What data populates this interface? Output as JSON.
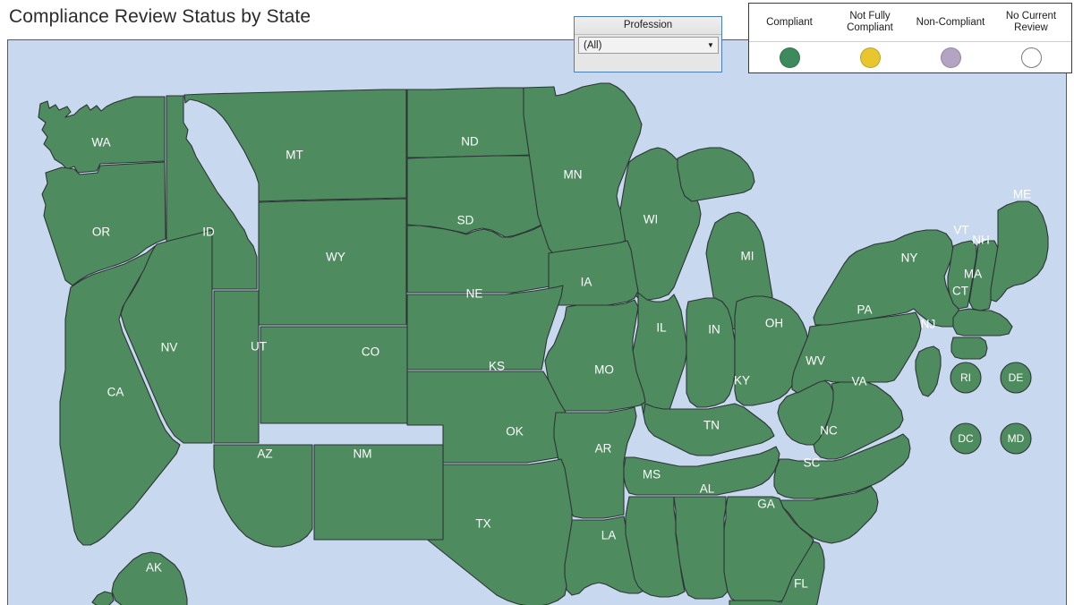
{
  "header": {
    "title": "Compliance Review Status by State"
  },
  "filter": {
    "name": "profession-filter",
    "title": "Profession",
    "selected_value": "(All)",
    "caret_icon": "chevron-down-icon",
    "options": [
      "(All)"
    ]
  },
  "legend": {
    "items": [
      {
        "label": "Compliant",
        "label_lines": [
          "Compliant"
        ],
        "color": "#3d8b5c",
        "filled": true
      },
      {
        "label": "Not Fully Compliant",
        "label_lines": [
          "Not Fully",
          "Compliant"
        ],
        "color": "#e8c72e",
        "filled": true
      },
      {
        "label": "Non-Compliant",
        "label_lines": [
          "Non-Compliant"
        ],
        "color": "#b4a4c4",
        "filled": true
      },
      {
        "label": "No Current Review",
        "label_lines": [
          "No Current",
          "Review"
        ],
        "color": "#ffffff",
        "filled": false
      }
    ]
  },
  "map": {
    "background_color": "#c8d9ef",
    "state_fill_color": "#4e8c5f",
    "state_border_color": "#2e3436",
    "label_color": "#ffffff",
    "status_legend_key": "Compliant",
    "states": [
      {
        "code": "WA",
        "status": "Compliant"
      },
      {
        "code": "OR",
        "status": "Compliant"
      },
      {
        "code": "ID",
        "status": "Compliant"
      },
      {
        "code": "MT",
        "status": "Compliant"
      },
      {
        "code": "ND",
        "status": "Compliant"
      },
      {
        "code": "MN",
        "status": "Compliant"
      },
      {
        "code": "SD",
        "status": "Compliant"
      },
      {
        "code": "WY",
        "status": "Compliant"
      },
      {
        "code": "WI",
        "status": "Compliant"
      },
      {
        "code": "MI",
        "status": "Compliant"
      },
      {
        "code": "NE",
        "status": "Compliant"
      },
      {
        "code": "IA",
        "status": "Compliant"
      },
      {
        "code": "NY",
        "status": "Compliant"
      },
      {
        "code": "ME",
        "status": "Compliant"
      },
      {
        "code": "VT",
        "status": "Compliant"
      },
      {
        "code": "NH",
        "status": "Compliant"
      },
      {
        "code": "MA",
        "status": "Compliant"
      },
      {
        "code": "CT",
        "status": "Compliant"
      },
      {
        "code": "NV",
        "status": "Compliant"
      },
      {
        "code": "UT",
        "status": "Compliant"
      },
      {
        "code": "CO",
        "status": "Compliant"
      },
      {
        "code": "KS",
        "status": "Compliant"
      },
      {
        "code": "IL",
        "status": "Compliant"
      },
      {
        "code": "IN",
        "status": "Compliant"
      },
      {
        "code": "OH",
        "status": "Compliant"
      },
      {
        "code": "PA",
        "status": "Compliant"
      },
      {
        "code": "NJ",
        "status": "Compliant"
      },
      {
        "code": "CA",
        "status": "Compliant"
      },
      {
        "code": "MO",
        "status": "Compliant"
      },
      {
        "code": "KY",
        "status": "Compliant"
      },
      {
        "code": "WV",
        "status": "Compliant"
      },
      {
        "code": "VA",
        "status": "Compliant"
      },
      {
        "code": "AZ",
        "status": "Compliant"
      },
      {
        "code": "NM",
        "status": "Compliant"
      },
      {
        "code": "OK",
        "status": "Compliant"
      },
      {
        "code": "AR",
        "status": "Compliant"
      },
      {
        "code": "TN",
        "status": "Compliant"
      },
      {
        "code": "NC",
        "status": "Compliant"
      },
      {
        "code": "SC",
        "status": "Compliant"
      },
      {
        "code": "MS",
        "status": "Compliant"
      },
      {
        "code": "AL",
        "status": "Compliant"
      },
      {
        "code": "GA",
        "status": "Compliant"
      },
      {
        "code": "TX",
        "status": "Compliant"
      },
      {
        "code": "LA",
        "status": "Compliant"
      },
      {
        "code": "FL",
        "status": "Compliant"
      },
      {
        "code": "AK",
        "status": "Compliant"
      }
    ],
    "bubbles": [
      {
        "code": "RI",
        "status": "Compliant"
      },
      {
        "code": "DE",
        "status": "Compliant"
      },
      {
        "code": "DC",
        "status": "Compliant"
      },
      {
        "code": "MD",
        "status": "Compliant"
      }
    ]
  }
}
